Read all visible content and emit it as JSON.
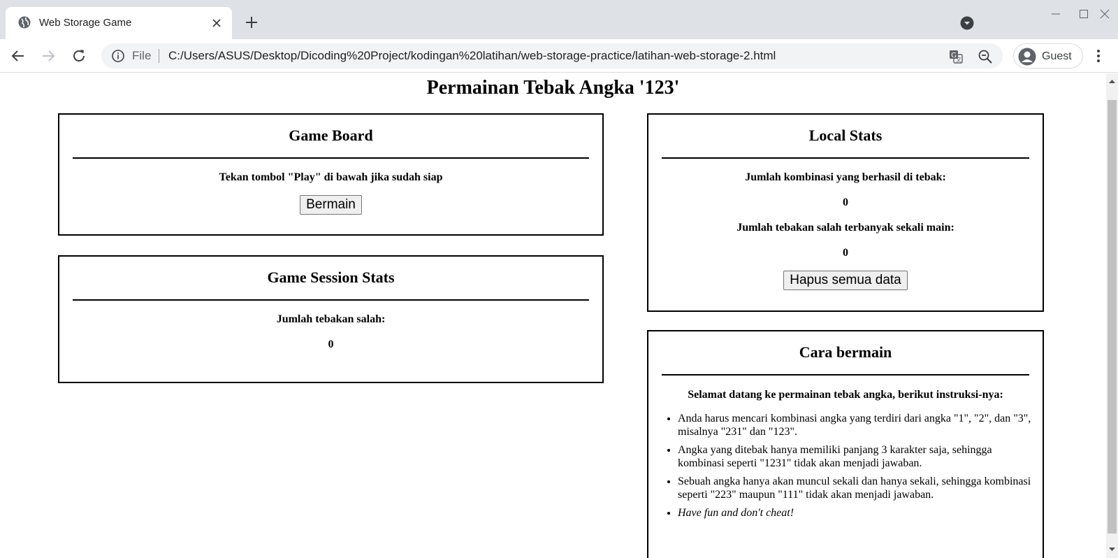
{
  "browser": {
    "tab_title": "Web Storage Game",
    "omnibox_file_label": "File",
    "url": "C:/Users/ASUS/Desktop/Dicoding%20Project/kodingan%20latihan/web-storage-practice/latihan-web-storage-2.html",
    "profile_label": "Guest"
  },
  "page": {
    "title": "Permainan Tebak Angka '123'"
  },
  "game_board": {
    "heading": "Game Board",
    "instruction": "Tekan tombol \"Play\" di bawah jika sudah siap",
    "play_button": "Bermain"
  },
  "session_stats": {
    "heading": "Game Session Stats",
    "wrong_guesses_label": "Jumlah tebakan salah:",
    "wrong_guesses_value": "0"
  },
  "local_stats": {
    "heading": "Local Stats",
    "success_label": "Jumlah kombinasi yang berhasil di tebak:",
    "success_value": "0",
    "max_wrong_label": "Jumlah tebakan salah terbanyak sekali main:",
    "max_wrong_value": "0",
    "clear_button": "Hapus semua data"
  },
  "how_to_play": {
    "heading": "Cara bermain",
    "intro": "Selamat datang ke permainan tebak angka, berikut instruksi-nya:",
    "items": [
      "Anda harus mencari kombinasi angka yang terdiri dari angka \"1\", \"2\", dan \"3\", misalnya \"231\" dan \"123\".",
      "Angka yang ditebak hanya memiliki panjang 3 karakter saja, sehingga kombinasi seperti \"1231\" tidak akan menjadi jawaban.",
      "Sebuah angka hanya akan muncul sekali dan hanya sekali, sehingga kombinasi seperti \"223\" maupun \"111\" tidak akan menjadi jawaban.",
      "Have fun and don't cheat!"
    ]
  },
  "icons": {
    "favicon": "globe-icon",
    "tab_close": "close-icon",
    "new_tab": "plus-icon",
    "tab_search": "tab-search-icon",
    "back": "back-arrow-icon",
    "forward": "forward-arrow-icon",
    "reload": "reload-icon",
    "site_info": "info-icon",
    "translate": "translate-icon",
    "zoom": "zoom-out-icon",
    "avatar": "avatar-icon",
    "menu": "kebab-menu-icon"
  },
  "colors": {
    "tab_strip": "#dee1e6",
    "omnibox": "#f1f3f4",
    "card_border": "#000000",
    "button_bg": "#efefef"
  }
}
